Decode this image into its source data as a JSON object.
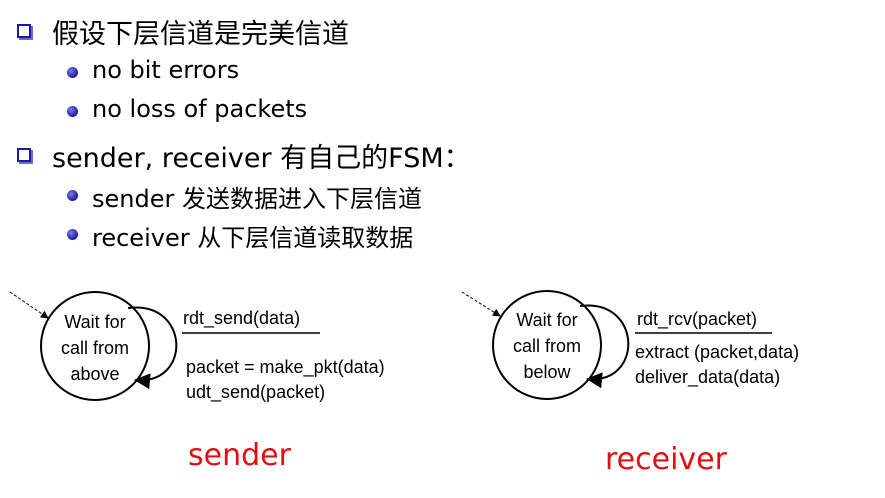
{
  "bullets": [
    {
      "text": "假设下层信道是完美信道",
      "sub": [
        {
          "text": "no bit errors"
        },
        {
          "text": "no loss of packets"
        }
      ]
    },
    {
      "text": "sender, receiver 有自己的FSM：",
      "sub": [
        {
          "text": "sender 发送数据进入下层信道"
        },
        {
          "text": "receiver 从下层信道读取数据"
        }
      ]
    }
  ],
  "sender_fsm": {
    "state_lines": [
      "Wait for",
      "call from",
      "above"
    ],
    "event": "rdt_send(data)",
    "actions": [
      "packet = make_pkt(data)",
      "udt_send(packet)"
    ],
    "label": "sender"
  },
  "receiver_fsm": {
    "state_lines": [
      "Wait for",
      "call from",
      "below"
    ],
    "event": "rdt_rcv(packet)",
    "actions": [
      "extract (packet,data)",
      "deliver_data(data)"
    ],
    "label": "receiver"
  },
  "colors": {
    "bullet": "#1a1aa6",
    "label": "#e01010"
  }
}
